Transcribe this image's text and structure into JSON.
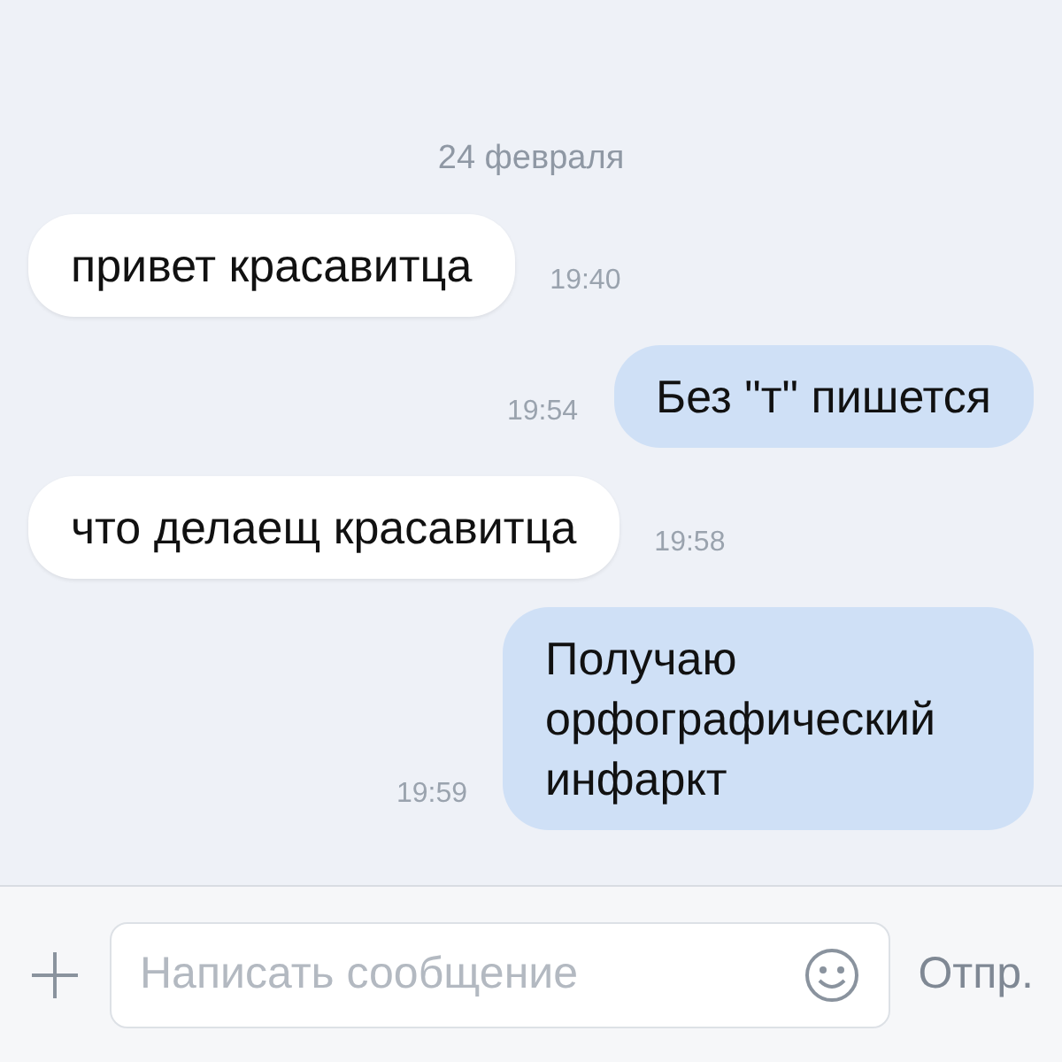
{
  "date": "24 февраля",
  "messages": [
    {
      "kind": "incoming",
      "text": "привет красавитца",
      "time": "19:40"
    },
    {
      "kind": "outgoing",
      "text": "Без \"т\" пишется",
      "time": "19:54"
    },
    {
      "kind": "incoming",
      "text": "что делаещ красавитца",
      "time": "19:58"
    },
    {
      "kind": "outgoing",
      "text": "Получаю орфографический инфаркт",
      "time": "19:59"
    }
  ],
  "composer": {
    "placeholder": "Написать сообщение",
    "send_label": "Отпр."
  }
}
